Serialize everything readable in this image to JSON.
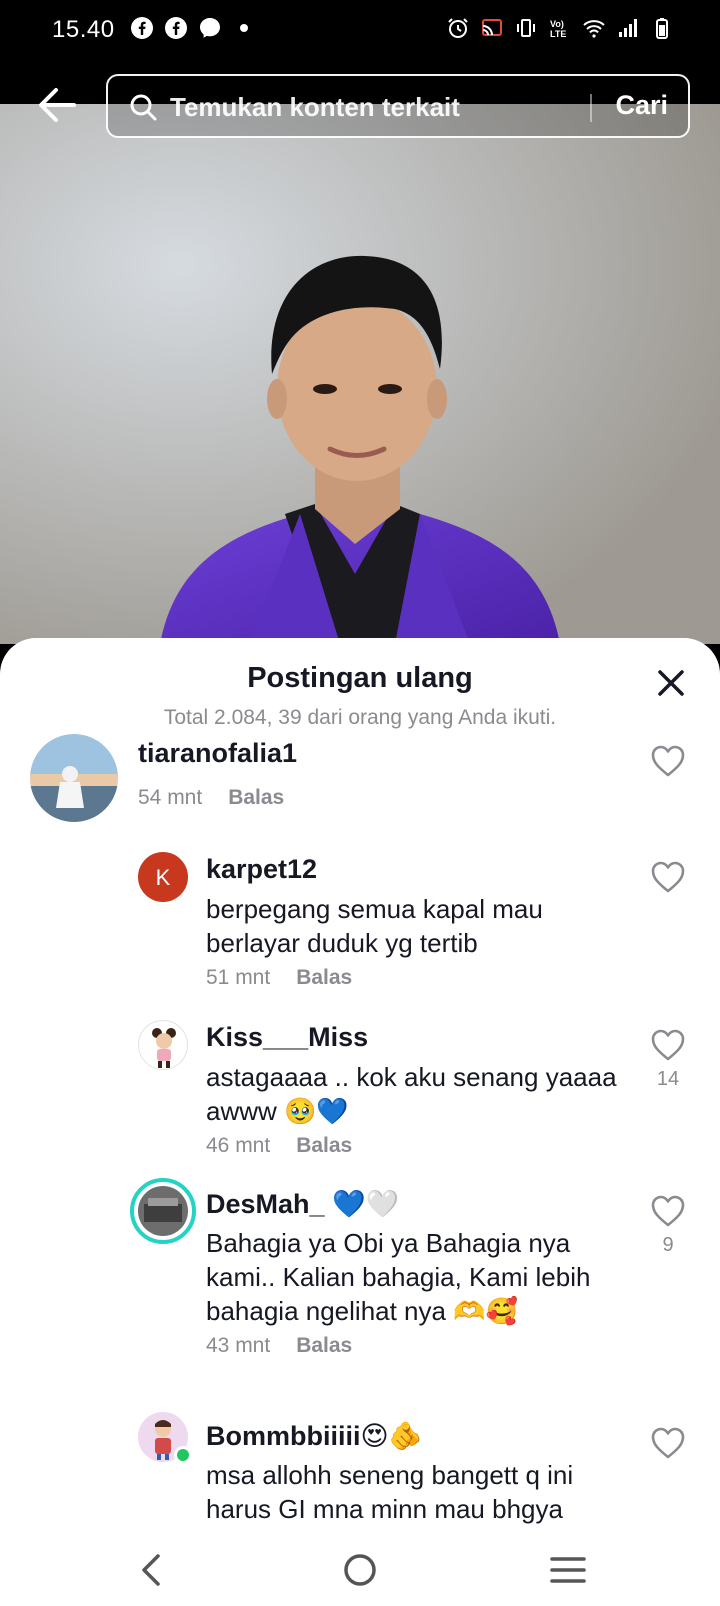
{
  "status_bar": {
    "time": "15.40",
    "left_icons": [
      "facebook-icon",
      "facebook-icon",
      "messenger-icon",
      "dot-icon"
    ],
    "right_icons": [
      "alarm-icon",
      "cast-icon",
      "vibrate-icon",
      "volte-icon",
      "wifi-icon",
      "signal-icon",
      "battery-icon"
    ]
  },
  "header": {
    "search_placeholder": "Temukan konten terkait",
    "search_button": "Cari"
  },
  "sheet": {
    "title": "Postingan ulang",
    "subtitle": "Total 2.084, 39 dari orang yang Anda ikuti.",
    "comments": [
      {
        "username": "tiaranofalia1",
        "text": "",
        "time": "54 mnt",
        "reply": "Balas",
        "likes": ""
      },
      {
        "username": "karpet12",
        "avatar_letter": "K",
        "text": "berpegang semua kapal mau berlayar duduk yg tertib",
        "time": "51 mnt",
        "reply": "Balas",
        "likes": ""
      },
      {
        "username": "Kiss___Miss",
        "text": "astagaaaa .. kok aku senang yaaaa awww 🥹💙",
        "time": "46 mnt",
        "reply": "Balas",
        "likes": "14"
      },
      {
        "username": "DesMah_ 💙🤍",
        "text": "Bahagia ya Obi ya Bahagia nya kami.. Kalian bahagia, Kami lebih bahagia ngelihat nya 🫶🥰",
        "time": "43 mnt",
        "reply": "Balas",
        "likes": "9"
      },
      {
        "username": "Bommbbiiiii😍🫵",
        "text": "msa allohh seneng bangett q ini harus GI mna minn mau bhgya",
        "time": "",
        "reply": "",
        "likes": ""
      }
    ]
  },
  "colors": {
    "accent_ring": "#25d3c4",
    "avatar_k": "#c8381f",
    "online": "#22c55e"
  }
}
